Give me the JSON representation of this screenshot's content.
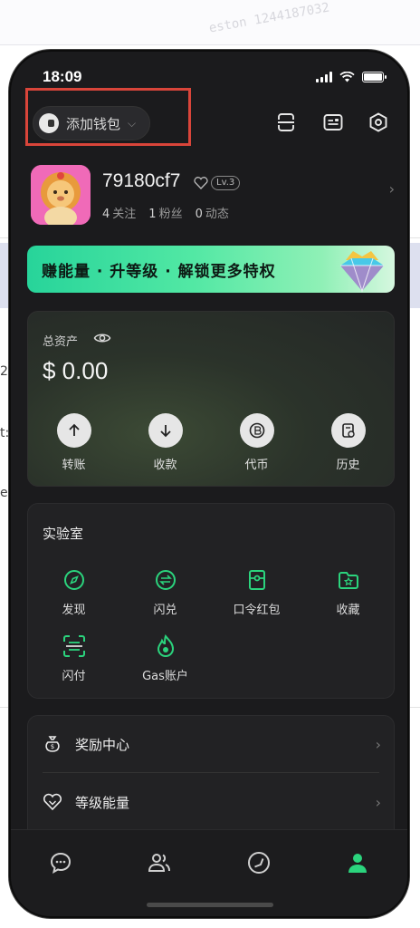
{
  "background": {
    "watermark": "eston 1244187032",
    "side_chars": [
      "2",
      "t:",
      "ea"
    ]
  },
  "status_bar": {
    "time": "18:09"
  },
  "header": {
    "wallet_button": "添加钱包",
    "icons": [
      "scan-icon",
      "id-card-icon",
      "settings-hex-icon"
    ]
  },
  "profile": {
    "username": "79180cf7",
    "level": "Lv.3",
    "stats": [
      {
        "count": "4",
        "label": "关注"
      },
      {
        "count": "1",
        "label": "粉丝"
      },
      {
        "count": "0",
        "label": "动态"
      }
    ]
  },
  "banner": {
    "text": "赚能量 · 升等级 · 解锁更多特权"
  },
  "assets": {
    "label": "总资产",
    "value": "$ 0.00",
    "actions": [
      {
        "label": "转账",
        "icon": "arrow-up-icon"
      },
      {
        "label": "收款",
        "icon": "arrow-down-icon"
      },
      {
        "label": "代币",
        "icon": "coin-icon"
      },
      {
        "label": "历史",
        "icon": "history-icon"
      }
    ]
  },
  "lab": {
    "title": "实验室",
    "items": [
      {
        "label": "发现",
        "icon": "compass-icon"
      },
      {
        "label": "闪兑",
        "icon": "swap-icon"
      },
      {
        "label": "口令红包",
        "icon": "red-packet-icon"
      },
      {
        "label": "收藏",
        "icon": "star-folder-icon"
      },
      {
        "label": "闪付",
        "icon": "scan-pay-icon"
      },
      {
        "label": "Gas账户",
        "icon": "flame-icon"
      }
    ]
  },
  "menu": {
    "items": [
      {
        "label": "奖励中心",
        "icon": "money-bag-icon"
      },
      {
        "label": "等级能量",
        "icon": "heart-diamond-icon"
      }
    ]
  },
  "tabbar": {
    "tabs": [
      "chat-icon",
      "contacts-icon",
      "compass-tab-icon",
      "profile-icon"
    ],
    "active_color": "#2bd47d"
  },
  "colors": {
    "accent": "#2bd47d",
    "highlight": "#d9453a"
  }
}
